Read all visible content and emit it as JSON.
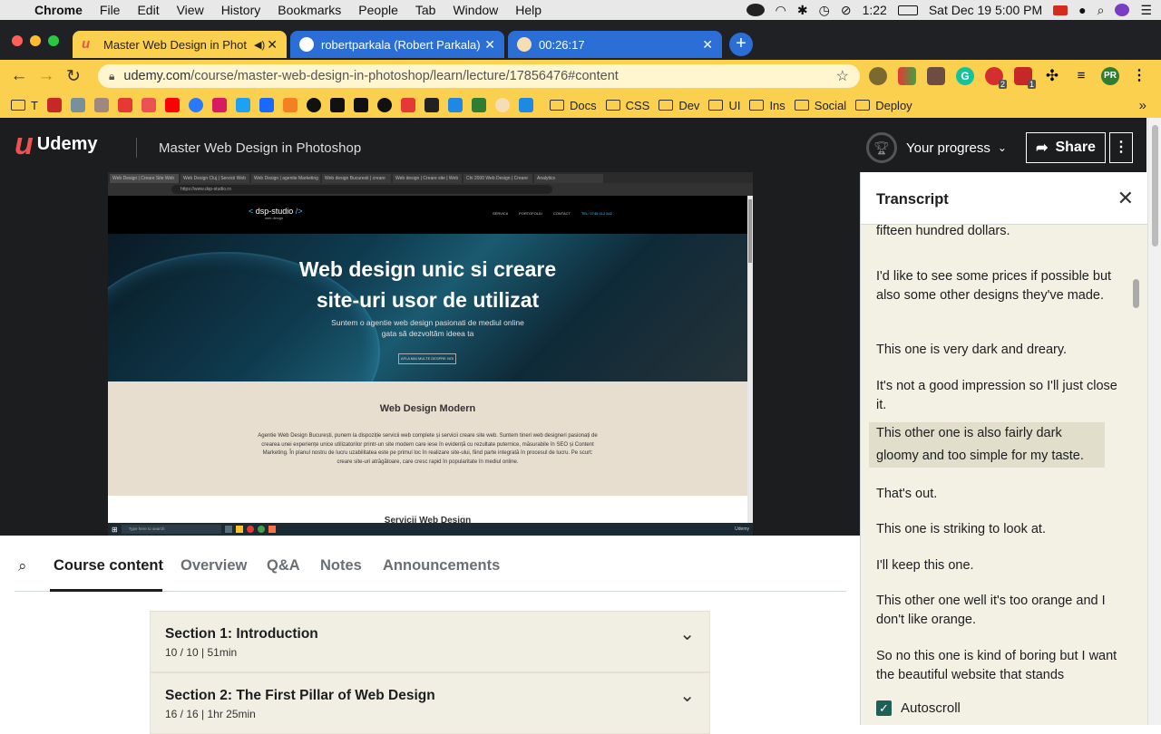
{
  "menubar": {
    "app": "Chrome",
    "items": [
      "File",
      "Edit",
      "View",
      "History",
      "Bookmarks",
      "People",
      "Tab",
      "Window",
      "Help"
    ],
    "time_remaining": "1:22",
    "datetime": "Sat Dec 19  5:00 PM"
  },
  "tabs": [
    {
      "title": "Master Web Design in Phot",
      "active": true
    },
    {
      "title": "robertparkala (Robert Parkala)",
      "active": false
    },
    {
      "title": "00:26:17",
      "active": false
    }
  ],
  "toolbar": {
    "url_domain": "udemy.com",
    "url_path": "/course/master-web-design-in-photoshop/learn/lecture/17856476#content",
    "badge_2": "2",
    "badge_1": "1",
    "profile": "PR"
  },
  "bookmarks": {
    "first": "T",
    "folders": [
      "Docs",
      "CSS",
      "Dev",
      "UI",
      "Ins",
      "Social",
      "Deploy"
    ],
    "overflow": "»"
  },
  "header": {
    "logo": "Udemy",
    "course_title": "Master Web Design in Photoshop",
    "progress_label": "Your progress",
    "share_label": "Share"
  },
  "video": {
    "inner_tabs": [
      "Web Design | Creare Site Web",
      "Web Design Cluj | Servicii Web",
      "Web Design | agentie Marketing",
      "Web design Bucuresti | creare",
      "Web design | Creare site | Web",
      "Chi 2000 Web Design | Creare",
      "Analytics"
    ],
    "inner_url": "https://www.dsp-studio.ro",
    "brand": "dsp-studio",
    "brand_sub": "web design",
    "nav_links": [
      "SERVICII",
      "PORTOFOLIU",
      "CONTACT",
      "TEL: 0745 012 542"
    ],
    "hero_title_1": "Web design unic si creare",
    "hero_title_2": "site-uri usor de utilizat",
    "hero_sub_1": "Suntem o agentie web design pasionati de mediul online",
    "hero_sub_2": "gata să dezvoltăm ideea ta",
    "hero_cta": "AFLA MAI MULTE DESPRE NOI",
    "section_title": "Web Design Modern",
    "section_text": "Agentie Web Design București, punem la dispoziție servicii web complete și servicii creare site web. Suntem tineri web designeri pasionați de crearea unei experiențe unice utilizatorilor printr-un site modern care iese în evidență cu rezultate puternice, măsurabile în SEO și Content Marketing. În planul nostru de lucru uzabilitatea este pe primul loc în realizare site-ului, fiind parte integrată în procesul de lucru. Pe scurt: creare site-uri atrăgătoare, care cresc rapid în popularitate în mediul online.",
    "next_section": "Servicii Web Design",
    "taskbar_search": "Type here to search",
    "taskbar_brand": "Udemy"
  },
  "course_tabs": [
    "Course content",
    "Overview",
    "Q&A",
    "Notes",
    "Announcements"
  ],
  "sections": [
    {
      "title": "Section 1: Introduction",
      "stats": "10 / 10 | 51min"
    },
    {
      "title": "Section 2: The First Pillar of Web Design",
      "stats": "16 / 16 | 1hr 25min"
    }
  ],
  "transcript": {
    "title": "Transcript",
    "cues": [
      "fifteen hundred dollars.",
      "I'd like to see some prices if possible but also some other designs they've made.",
      "This one is very dark and dreary.",
      "It's not a good impression so I'll just close it.",
      "This other one is also fairly dark gloomy and too simple for my taste.",
      "That's out.",
      "This one is striking to look at.",
      "I'll keep this one.",
      "This other one well it's too orange and I don't like orange.",
      "So no this one is kind of boring but I want the beautiful website that stands"
    ],
    "autoscroll_label": "Autoscroll"
  }
}
